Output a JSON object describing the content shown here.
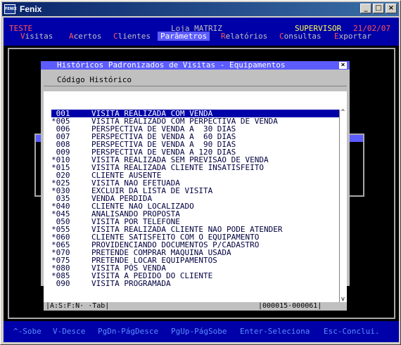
{
  "window": {
    "title": "Fenix",
    "icon_label": "FENIX",
    "buttons": {
      "minimize": "_",
      "maximize": "□",
      "close": "×"
    }
  },
  "header": {
    "company": "TESTE",
    "store": "Loja MATRIZ",
    "user": "SUPERVISOR",
    "date": "21/02/07"
  },
  "menu": [
    {
      "hot": "V",
      "rest": "isitas"
    },
    {
      "hot": "A",
      "rest": "certos"
    },
    {
      "hot": "C",
      "rest": "lientes"
    },
    {
      "hot": "P",
      "rest": "arâmetros"
    },
    {
      "hot": "R",
      "rest": "elatórios"
    },
    {
      "hot": "C",
      "rest": "onsultas"
    },
    {
      "hot": "E",
      "rest": "xportar"
    }
  ],
  "dialog": {
    "title": "Históricos Padronizados de Visitas - Equipamentos",
    "close": "×",
    "column_header": "Código Histórico",
    "rows": [
      {
        "code": " 001",
        "desc": "VISITA REALIZADA COM VENDA"
      },
      {
        "code": "*005",
        "desc": "VISITA REALIZADO COM PERPECTIVA DE VENDA"
      },
      {
        "code": " 006",
        "desc": "PERSPECTIVA DE VENDA A  30 DIAS"
      },
      {
        "code": " 007",
        "desc": "PERSPECTIVA DE VENDA A  60 DIAS"
      },
      {
        "code": " 008",
        "desc": "PERSPECTIVA DE VENDA A  90 DIAS"
      },
      {
        "code": " 009",
        "desc": "PERSPECTIVA DE VENDA A 120 DIAS"
      },
      {
        "code": "*010",
        "desc": "VISITA REALIZADA SEM PREVISAO DE VENDA"
      },
      {
        "code": "*015",
        "desc": "VISITA REALIZADA CLIENTE INSATISFEITO"
      },
      {
        "code": " 020",
        "desc": "CLIENTE AUSENTE"
      },
      {
        "code": "*025",
        "desc": "VISITA NAO EFETUADA"
      },
      {
        "code": "*030",
        "desc": "EXCLUIR DA LISTA DE VISITA"
      },
      {
        "code": " 035",
        "desc": "VENDA PERDIDA"
      },
      {
        "code": "*040",
        "desc": "CLIENTE NAO LOCALIZADO"
      },
      {
        "code": "*045",
        "desc": "ANALISANDO PROPOSTA"
      },
      {
        "code": " 050",
        "desc": "VISITA POR TELEFONE"
      },
      {
        "code": "*055",
        "desc": "VISITA REALIZADA CLIENTE NAO PODE ATENDER"
      },
      {
        "code": "*060",
        "desc": "CLIENTE SATISFEITO COM O EQUIPAMENTO"
      },
      {
        "code": "*065",
        "desc": "PROVIDENCIANDO DOCUMENTOS P/CADASTRO"
      },
      {
        "code": "*070",
        "desc": "PRETENDE COMPRAR MAQUINA USADA"
      },
      {
        "code": "*075",
        "desc": "PRETENDE LOCAR EQUIPAMENTOS"
      },
      {
        "code": "*080",
        "desc": "VISITA PÓS VENDA"
      },
      {
        "code": "*085",
        "desc": "VISITA A PEDIDO DO CLIENTE"
      },
      {
        "code": " 090",
        "desc": "VISITA PROGRAMADA"
      }
    ],
    "selected_index": 0,
    "scroll_up": "^",
    "scroll_down": "v",
    "footer_keys": "|A:S:F:N· ·Tab|",
    "footer_count": "|000015·000061|"
  },
  "hints": [
    "^-Sobe",
    "V-Desce",
    "PgDn-PágDesce",
    "PgUp-PágSobe",
    "Enter-Seleciona",
    "Esc-Conclui."
  ],
  "colors": {
    "console_blue": "#0000a8",
    "highlight": "#5c5cff",
    "hotkey": "#ff5555",
    "header_red": "#ff5555",
    "header_yellow": "#ffff55",
    "header_white": "#c0c0c0"
  }
}
